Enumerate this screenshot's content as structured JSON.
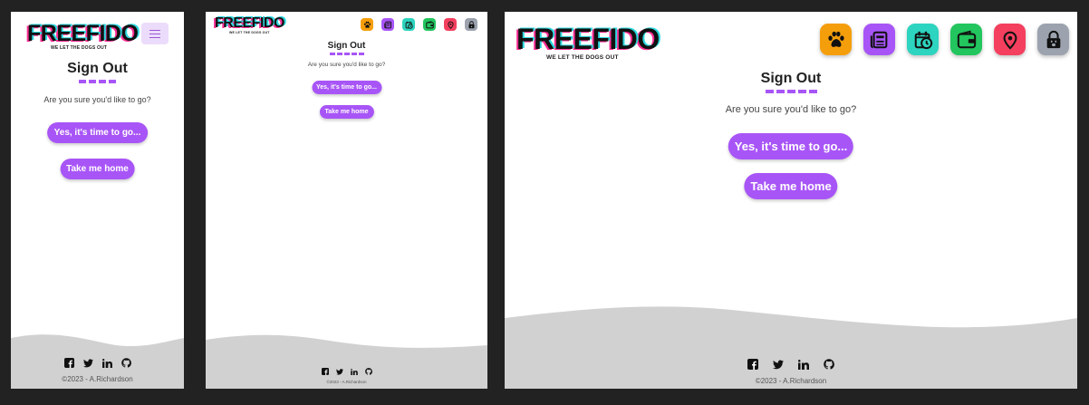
{
  "brand": {
    "name": "FREEFIDO",
    "tagline": "WE LET THE DOGS OUT"
  },
  "page": {
    "title": "Sign Out",
    "question": "Are you sure you'd like to go?",
    "confirm_label": "Yes, it's time to go...",
    "home_label": "Take me home"
  },
  "footer": {
    "copyright": "©2023 - A.Richardson",
    "social": [
      "facebook-icon",
      "twitter-icon",
      "linkedin-icon",
      "github-icon"
    ]
  },
  "nav": {
    "items": [
      {
        "icon": "paw-icon",
        "color": "#f59e0b"
      },
      {
        "icon": "newspaper-icon",
        "color": "#a855f7"
      },
      {
        "icon": "calendar-clock-icon",
        "color": "#2dd4bf"
      },
      {
        "icon": "wallet-icon",
        "color": "#22c55e"
      },
      {
        "icon": "map-pin-icon",
        "color": "#f43f5e"
      },
      {
        "icon": "lock-paw-icon",
        "color": "#9ca3af"
      }
    ]
  },
  "colors": {
    "accent": "#a855f7",
    "menu_bg": "#ecdcfb",
    "wave": "#d1d1d1",
    "backdrop": "#222222"
  }
}
